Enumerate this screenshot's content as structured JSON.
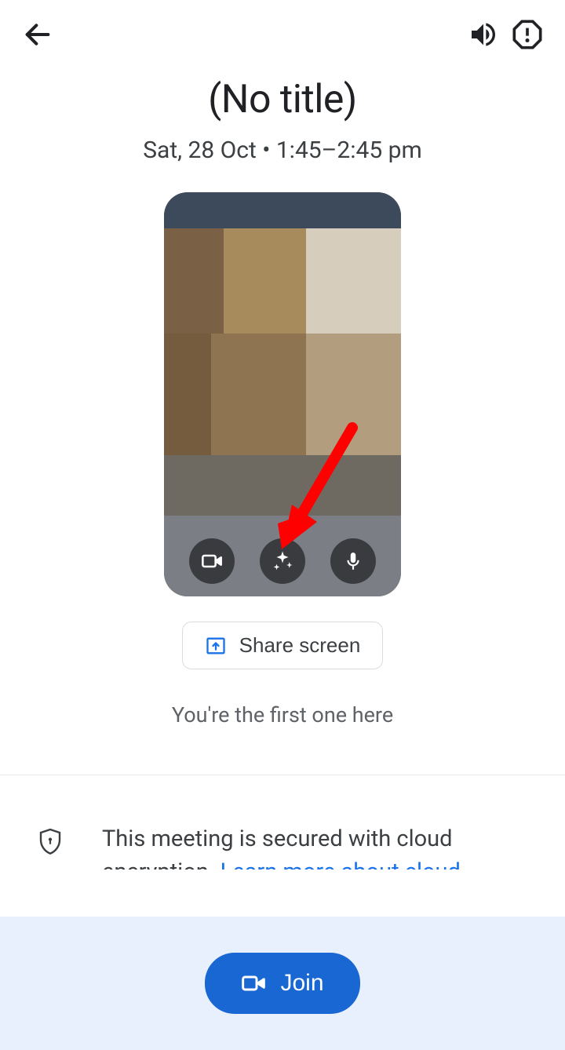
{
  "meeting": {
    "title": "(No title)",
    "datetime": "Sat, 28 Oct • 1:45–2:45 pm"
  },
  "share": {
    "label": "Share screen"
  },
  "status": {
    "first_here": "You're the first one here"
  },
  "security": {
    "text": "This meeting is secured with cloud encryption. ",
    "link": "Learn more about cloud encryption"
  },
  "join": {
    "label": "Join"
  }
}
